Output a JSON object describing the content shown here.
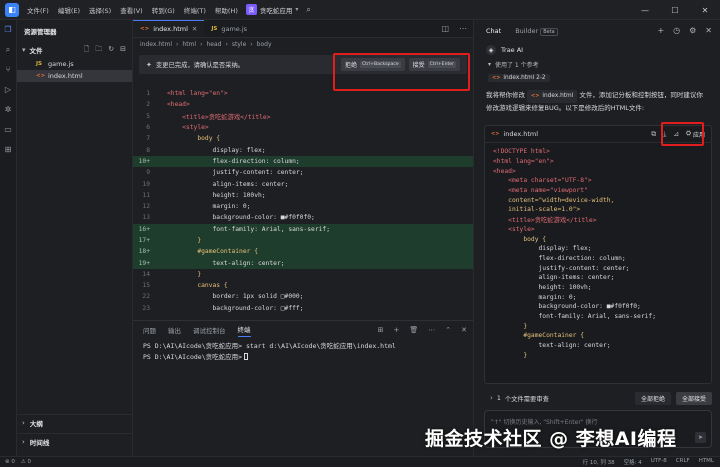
{
  "menu": [
    "文件(F)",
    "编辑(E)",
    "选择(S)",
    "查看(V)",
    "转到(G)",
    "终端(T)",
    "帮助(H)"
  ],
  "project": {
    "badge": "贪",
    "name": "贪吃蛇应用"
  },
  "explorer": {
    "title": "资源管理器",
    "folder": "文件",
    "files": [
      {
        "name": "game.js",
        "icon": "JS"
      },
      {
        "name": "index.html",
        "icon": "<>"
      }
    ],
    "outline": "大纲",
    "timeline": "时间线"
  },
  "editor": {
    "tabs": [
      {
        "name": "index.html",
        "icon": "<>"
      },
      {
        "name": "game.js",
        "icon": "JS"
      }
    ],
    "crumbs": [
      "index.html",
      "html",
      "head",
      "style",
      "body"
    ],
    "notice": "变更已完成，请确认是否采纳。",
    "reject": {
      "label": "拒绝",
      "key": "Ctrl+Backspace"
    },
    "accept": {
      "label": "接受",
      "key": "Ctrl+Enter"
    },
    "lines": [
      {
        "n": "1",
        "t": "<html lang=\"en\">"
      },
      {
        "n": "2",
        "t": "<head>"
      },
      {
        "n": "5",
        "t": "    <title>贪吃蛇游戏</title>"
      },
      {
        "n": "6",
        "t": "    <style>"
      },
      {
        "n": "7",
        "t": "        body {"
      },
      {
        "n": "8",
        "t": "            display: flex;"
      },
      {
        "n": "10+",
        "t": "            flex-direction: column;"
      },
      {
        "n": "9",
        "t": "            justify-content: center;"
      },
      {
        "n": "10",
        "t": "            align-items: center;"
      },
      {
        "n": "11",
        "t": "            height: 100vh;"
      },
      {
        "n": "12",
        "t": "            margin: 0;"
      },
      {
        "n": "13",
        "t": "            background-color: ■#f0f0f0;"
      },
      {
        "n": "16+",
        "t": "            font-family: Arial, sans-serif;"
      },
      {
        "n": "17+",
        "t": "        }"
      },
      {
        "n": "18+",
        "t": "        #gameContainer {"
      },
      {
        "n": "19+",
        "t": "            text-align: center;"
      },
      {
        "n": "14",
        "t": "        }"
      },
      {
        "n": "15",
        "t": "        canvas {"
      },
      {
        "n": "22",
        "t": "            border: 1px solid □#000;"
      },
      {
        "n": "23",
        "t": "            background-color: □#fff;"
      }
    ]
  },
  "terminal": {
    "tabs": [
      "问题",
      "输出",
      "调试控制台",
      "终端"
    ],
    "line1": "PS D:\\AI\\AIcode\\贪吃蛇应用> start d:\\AI\\AIcode\\贪吃蛇应用\\index.html",
    "line2": "PS D:\\AI\\AIcode\\贪吃蛇应用>"
  },
  "chat": {
    "tab_chat": "Chat",
    "tab_builder": "Builder",
    "builder_badge": "Beta",
    "assistant": "Trae AI",
    "refs": "使用了 1 个参考",
    "ref_chip": "index.html 2-2",
    "msg_pre": "我将帮你修改",
    "msg_chip": "index.html",
    "msg_post": "文件，添加记分板和控制按钮，同时建议你修改游戏逻辑来修复BUG。以下是修改后的HTML文件:",
    "block_file": "index.html",
    "apply": "应用",
    "code": [
      "<!DOCTYPE html>",
      "<html lang=\"en\">",
      "<head>",
      "    <meta charset=\"UTF-8\">",
      "    <meta name=\"viewport\"",
      "    content=\"width=device-width,",
      "    initial-scale=1.0\">",
      "    <title>贪吃蛇游戏</title>",
      "    <style>",
      "        body {",
      "            display: flex;",
      "            flex-direction: column;",
      "            justify-content: center;",
      "            align-items: center;",
      "            height: 100vh;",
      "            margin: 0;",
      "            background-color: ■#f0f0f0;",
      "            font-family: Arial, sans-serif;",
      "        }",
      "        #gameContainer {",
      "            text-align: center;",
      "        }"
    ],
    "review_count": "1",
    "review_text": "个文件需要审查",
    "reject_all": "全部拒绝",
    "accept_all": "全部接受",
    "input_placeholder": "\"↑\" 切换历史输入, \"Shift+Enter\" 换行"
  },
  "status": {
    "left": [
      "⊗ 0",
      "⚠ 0"
    ],
    "right": [
      "行 10, 列 38",
      "空格: 4",
      "UTF-8",
      "CRLF",
      "HTML"
    ]
  },
  "watermark": "掘金技术社区 @ 李想AI编程",
  "colors": {
    "highlight": "#e11d1d",
    "accent": "#4c7cf3"
  }
}
